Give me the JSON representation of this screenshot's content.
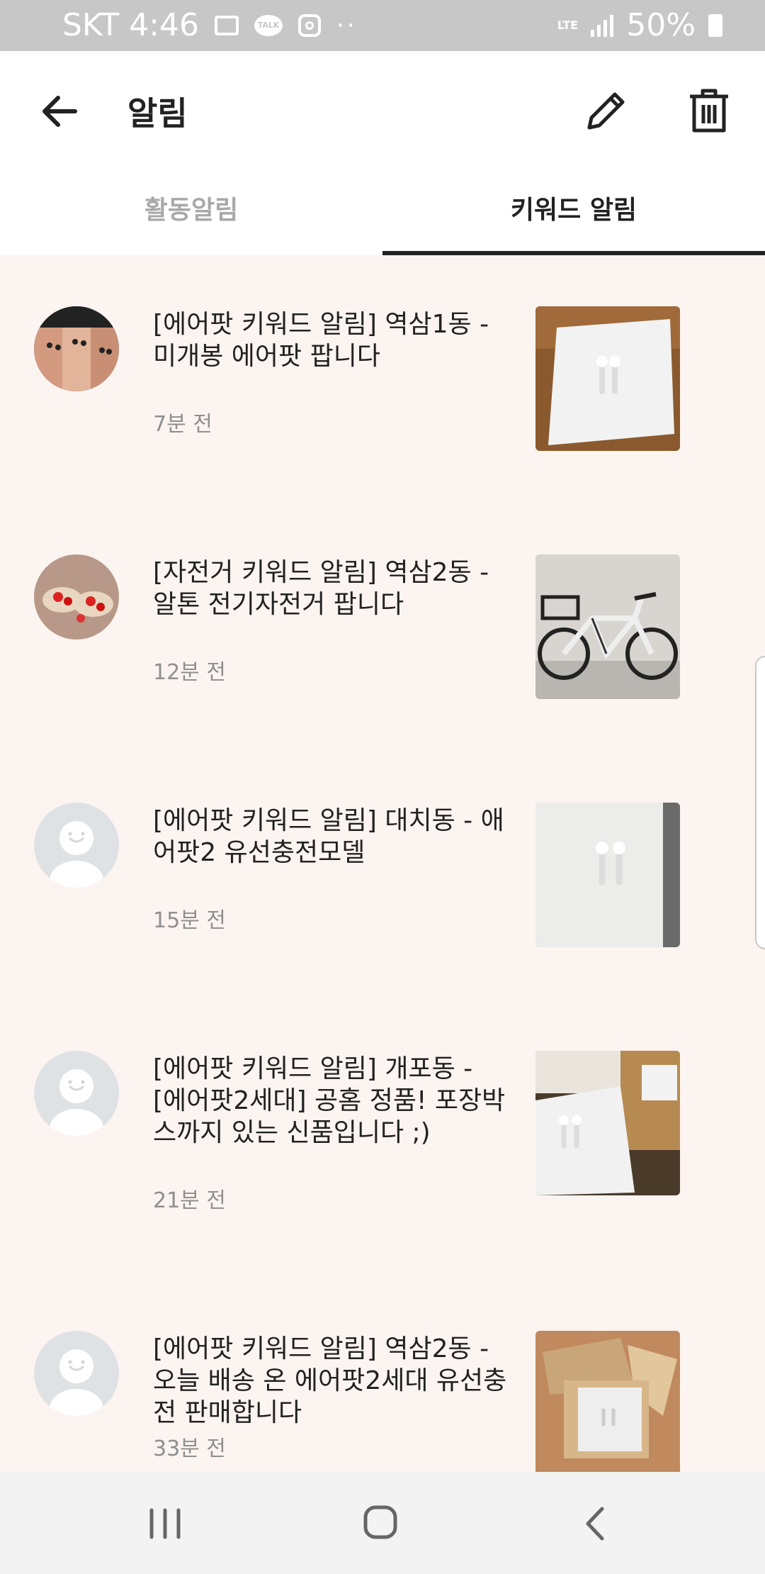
{
  "status_bar": {
    "carrier_time": "SKT 4:46",
    "talk_label": "TALK",
    "dots": "··",
    "network": "LTE",
    "battery": "50%"
  },
  "app_bar": {
    "title": "알림",
    "icons": [
      "back-arrow-icon",
      "pencil-icon",
      "trash-icon"
    ]
  },
  "tabs": [
    {
      "label": "활동알림",
      "selected": false
    },
    {
      "label": "키워드 알림",
      "selected": true
    }
  ],
  "notifications": [
    {
      "title": "[에어팟 키워드 알림] 역삼1동 - 미개봉 에어팟 팝니다",
      "time": "7분 전",
      "avatar": "photo-faces",
      "thumbnail": "airpods-box"
    },
    {
      "title": "[자전거 키워드 알림] 역삼2동 - 알톤 전기자전거 팝니다",
      "time": "12분 전",
      "avatar": "photo-food",
      "thumbnail": "electric-bicycle"
    },
    {
      "title": "[에어팟 키워드 알림] 대치동 - 애어팟2 유선충전모델",
      "time": "15분 전",
      "avatar": "default-profile",
      "thumbnail": "airpods-box"
    },
    {
      "title": "[에어팟 키워드 알림] 개포동 - [에어팟2세대] 공홈 정품! 포장박스까지 있는 신품입니다 ;)",
      "time": "21분 전",
      "avatar": "default-profile",
      "thumbnail": "airpods-box-keyboard"
    },
    {
      "title": "[에어팟 키워드 알림] 역삼2동 - 오늘 배송 온 에어팟2세대 유선충전 판매합니다",
      "time": "33분 전",
      "avatar": "default-profile",
      "thumbnail": "airpods-in-cardboard"
    }
  ],
  "colors": {
    "list_background": "#fcf4f0",
    "status_bar": "#c7c7c7",
    "active_tab_indicator": "#222222",
    "inactive_tab_text": "#a8a8a8",
    "time_text": "#8f8f8f"
  },
  "nav_bar": {
    "icons": [
      "recent-apps-icon",
      "home-icon",
      "nav-back-icon"
    ]
  }
}
